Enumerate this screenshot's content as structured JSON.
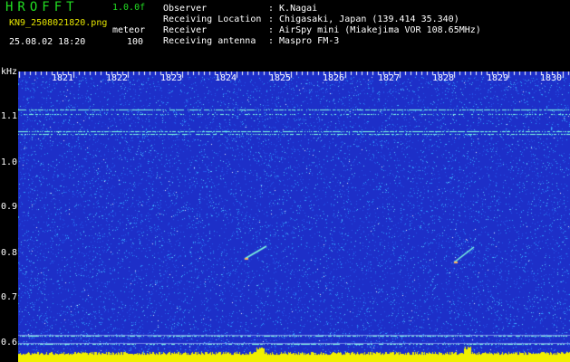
{
  "header": {
    "logo": "HROFFT",
    "version": "1.0.0f",
    "filename": "KN9_2508021820.png",
    "mode_label": "meteor",
    "timestamp": "25.08.02 18:20",
    "threshold": "100",
    "info": [
      {
        "label": "Observer",
        "value": ": K.Nagai"
      },
      {
        "label": "Receiving Location",
        "value": ": Chigasaki, Japan (139.414 35.340)"
      },
      {
        "label": "Receiver",
        "value": ": AirSpy mini (Miakejima VOR 108.65MHz)"
      },
      {
        "label": "Receiving antenna",
        "value": ": Maspro FM-3"
      }
    ]
  },
  "axis": {
    "unit": "kHz",
    "y_ticks": [
      "1.1",
      "1.0",
      "0.9",
      "0.8",
      "0.7",
      "0.6"
    ],
    "x_ticks": [
      "1821",
      "1822",
      "1823",
      "1824",
      "1825",
      "1826",
      "1827",
      "1828",
      "1829",
      "1830"
    ]
  },
  "colors": {
    "background": "#1d2fc8",
    "noise": "#30a0ff",
    "carrier": "#7fffe0",
    "baseline": "#f0f000"
  }
}
